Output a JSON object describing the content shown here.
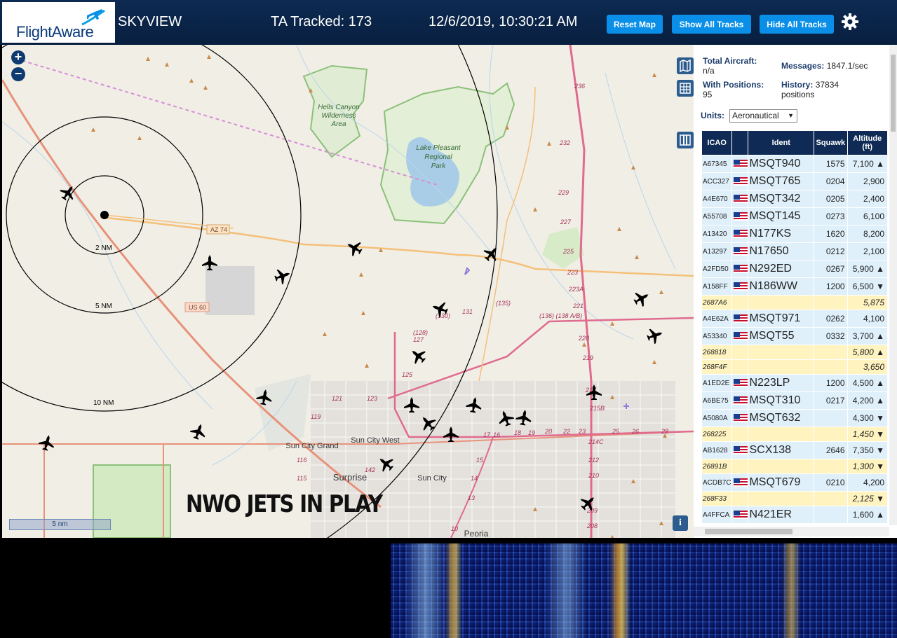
{
  "header": {
    "logo_text": "FlightAware",
    "site_title": "SKYVIEW",
    "ta_tracked": "TA Tracked: 173",
    "clock": "12/6/2019, 10:30:21 AM",
    "buttons": {
      "reset": "Reset Map",
      "show_all": "Show All Tracks",
      "hide_all": "Hide All Tracks"
    },
    "settings_icon": "gear-icon"
  },
  "map": {
    "zoom_in": "+",
    "zoom_out": "−",
    "scale_label": "5 nm",
    "info_label": "i",
    "overlay_text": "NWO JETS IN PLAY",
    "range_rings": [
      "2 NM",
      "5 NM",
      "10 NM"
    ],
    "place_labels": {
      "hells_canyon": [
        "Hells Canyon",
        "Wilderness",
        "Area"
      ],
      "lake_pleasant": [
        "Lake Pleasant",
        "Regional",
        "Park"
      ],
      "sun_city_grand": "Sun City Grand",
      "sun_city_west": "Sun City West",
      "sun_city": "Sun City",
      "surprise": "Surprise",
      "peoria": "Peoria"
    },
    "road_labels": {
      "az74": "AZ 74",
      "us60": "US 60",
      "r135": "(135)",
      "r130": "(130)",
      "r136": "(136) (138 A/B)",
      "r131": "131",
      "r128": "(128)",
      "r127": "127",
      "r125": "125",
      "r123": "123",
      "r121": "121",
      "r119": "119",
      "r116": "116",
      "r115": "115",
      "r142": "142",
      "r236": "236",
      "r232": "232",
      "r229": "229",
      "r227": "227",
      "r225": "225",
      "r223": "223",
      "r223a": "223A",
      "r221": "221",
      "r220": "220",
      "r219": "219",
      "r217": "217",
      "r215b": "215B",
      "r214": "214C",
      "r212": "212",
      "r210": "210",
      "r209": "209",
      "r208": "208",
      "r16": "16",
      "r17": "17",
      "r18": "18",
      "r19": "19",
      "r20": "20",
      "r22": "22",
      "r23": "23",
      "r25": "25",
      "r26": "26",
      "r28": "28",
      "r10": "10",
      "r13": "13",
      "r14": "14",
      "r15": "15"
    }
  },
  "panel": {
    "total_aircraft_label": "Total Aircraft:",
    "total_aircraft_value": "n/a",
    "with_positions_label": "With Positions:",
    "with_positions_value": "95",
    "messages_label": "Messages:",
    "messages_value": "1847.1/sec",
    "history_label": "History:",
    "history_value": "37834",
    "history_unit": "positions",
    "units_label": "Units:",
    "units_value": "Aeronautical",
    "columns": [
      "ICAO",
      "",
      "Ident",
      "Squawk",
      "Altitude (ft)"
    ],
    "rows": [
      {
        "icao": "A67345",
        "flag": true,
        "ident": "MSQT940",
        "squawk": "1575",
        "alt": "7,100 ▲"
      },
      {
        "icao": "ACC327",
        "flag": true,
        "ident": "MSQT765",
        "squawk": "0204",
        "alt": "2,900"
      },
      {
        "icao": "A4E670",
        "flag": true,
        "ident": "MSQT342",
        "squawk": "0205",
        "alt": "2,400"
      },
      {
        "icao": "A55708",
        "flag": true,
        "ident": "MSQT145",
        "squawk": "0273",
        "alt": "6,100"
      },
      {
        "icao": "A13420",
        "flag": true,
        "ident": "N177KS",
        "squawk": "1620",
        "alt": "8,200"
      },
      {
        "icao": "A13297",
        "flag": true,
        "ident": "N17650",
        "squawk": "0212",
        "alt": "2,100"
      },
      {
        "icao": "A2FD50",
        "flag": true,
        "ident": "N292ED",
        "squawk": "0267",
        "alt": "5,900 ▲"
      },
      {
        "icao": "A158FF",
        "flag": true,
        "ident": "N186WW",
        "squawk": "1200",
        "alt": "6,500 ▼"
      },
      {
        "icao": "2687A6",
        "flag": false,
        "ident": "",
        "squawk": "",
        "alt": "5,875",
        "nopos": true
      },
      {
        "icao": "A4E62A",
        "flag": true,
        "ident": "MSQT971",
        "squawk": "0262",
        "alt": "4,100"
      },
      {
        "icao": "A53340",
        "flag": true,
        "ident": "MSQT55",
        "squawk": "0332",
        "alt": "3,700 ▲"
      },
      {
        "icao": "268818",
        "flag": false,
        "ident": "",
        "squawk": "",
        "alt": "5,800 ▲",
        "nopos": true
      },
      {
        "icao": "268F4F",
        "flag": false,
        "ident": "",
        "squawk": "",
        "alt": "3,650",
        "nopos": true
      },
      {
        "icao": "A1ED2E",
        "flag": true,
        "ident": "N223LP",
        "squawk": "1200",
        "alt": "4,500 ▲"
      },
      {
        "icao": "A6BE75",
        "flag": true,
        "ident": "MSQT310",
        "squawk": "0217",
        "alt": "4,200 ▲"
      },
      {
        "icao": "A5080A",
        "flag": true,
        "ident": "MSQT632",
        "squawk": "",
        "alt": "4,300 ▼"
      },
      {
        "icao": "268225",
        "flag": false,
        "ident": "",
        "squawk": "",
        "alt": "1,450 ▼",
        "nopos": true
      },
      {
        "icao": "AB1628",
        "flag": true,
        "ident": "SCX138",
        "squawk": "2646",
        "alt": "7,350 ▼"
      },
      {
        "icao": "26891B",
        "flag": false,
        "ident": "",
        "squawk": "",
        "alt": "1,300 ▼",
        "nopos": true
      },
      {
        "icao": "ACDB7C",
        "flag": true,
        "ident": "MSQT679",
        "squawk": "0210",
        "alt": "4,200"
      },
      {
        "icao": "268F33",
        "flag": false,
        "ident": "",
        "squawk": "",
        "alt": "2,125 ▼",
        "nopos": true
      },
      {
        "icao": "A4FFCA",
        "flag": true,
        "ident": "N421ER",
        "squawk": "",
        "alt": "1,600 ▲"
      }
    ]
  },
  "colors": {
    "header_bg": "#0b2447",
    "button_blue": "#0a8fe8",
    "table_header": "#0e2a55",
    "row_position": "#dff0fb",
    "row_no_position": "#fff3bf",
    "map_bg": "#f1eee6"
  }
}
